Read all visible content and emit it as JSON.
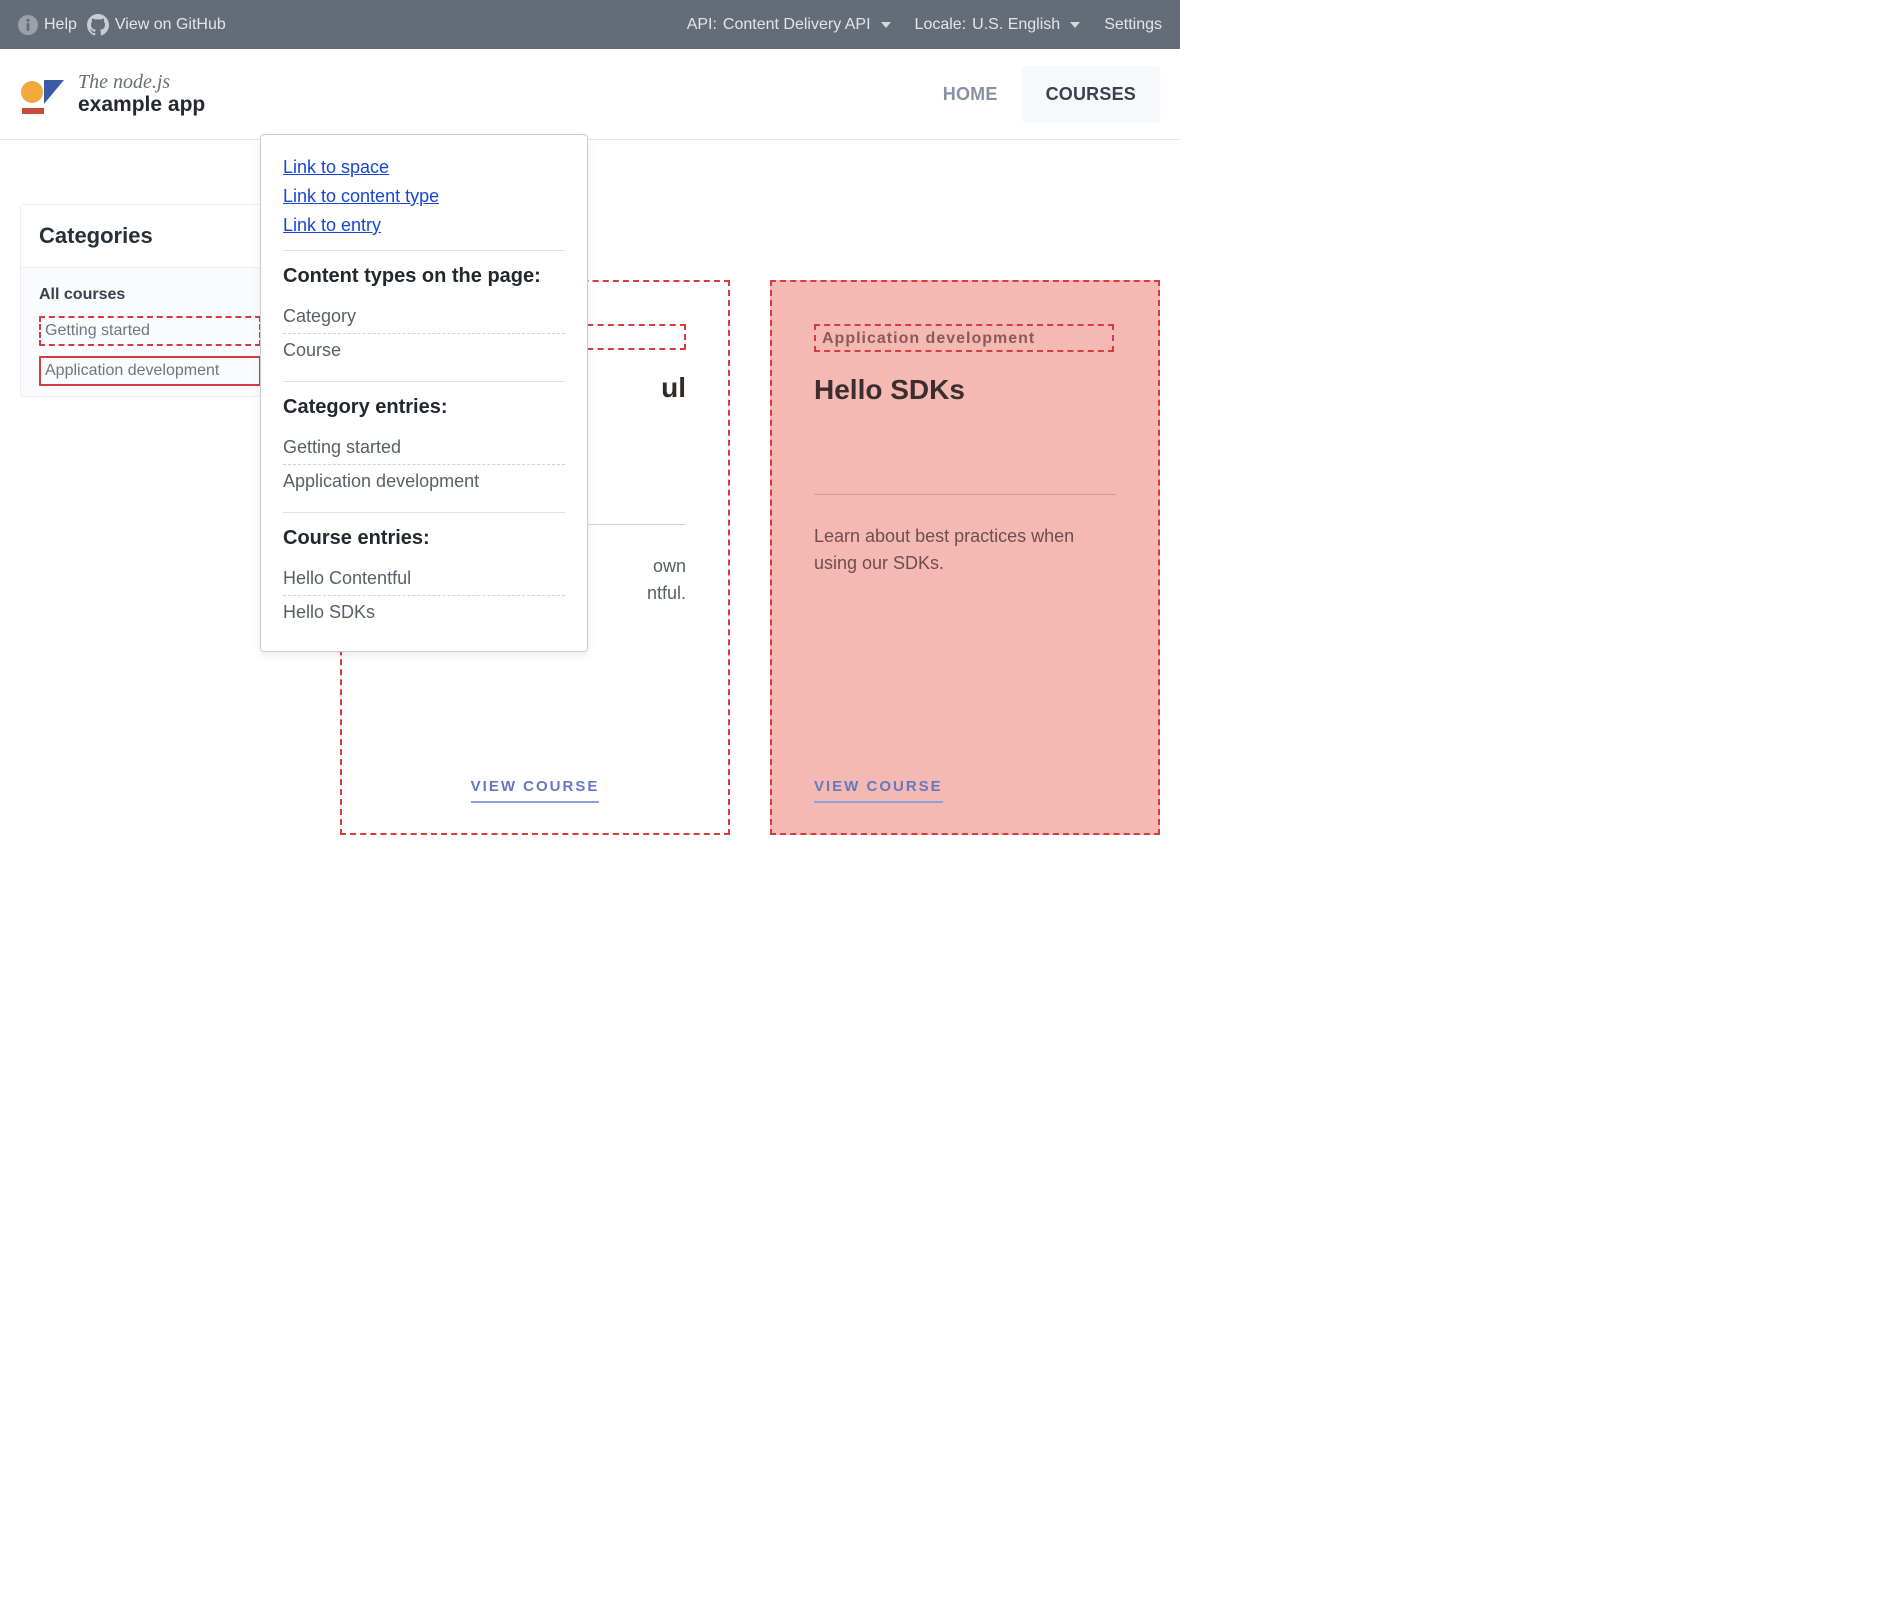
{
  "topbar": {
    "help": "Help",
    "github": "View on GitHub",
    "api_label": "API:",
    "api_value": "Content Delivery API",
    "locale_label": "Locale:",
    "locale_value": "U.S. English",
    "settings": "Settings"
  },
  "brand": {
    "line1": "The node.js",
    "line2": "example app"
  },
  "nav": {
    "home": "HOME",
    "courses": "COURSES"
  },
  "sidebar": {
    "title": "Categories",
    "all": "All courses",
    "items": [
      "Getting started",
      "Application development"
    ]
  },
  "popover": {
    "links": [
      "Link to space",
      "Link to content type",
      "Link to entry"
    ],
    "ct_heading": "Content types on the page:",
    "ct_items": [
      "Category",
      "Course"
    ],
    "cat_heading": "Category entries:",
    "cat_items": [
      "Getting started",
      "Application development"
    ],
    "course_heading": "Course entries:",
    "course_items": [
      "Hello Contentful",
      "Hello SDKs"
    ]
  },
  "cards": [
    {
      "category_suffix": "ul",
      "desc_l1": "own",
      "desc_l2": "ntful.",
      "view": "VIEW COURSE"
    },
    {
      "category": "Application development",
      "title": "Hello SDKs",
      "desc": "Learn about best practices when using our SDKs.",
      "view": "VIEW COURSE"
    }
  ]
}
